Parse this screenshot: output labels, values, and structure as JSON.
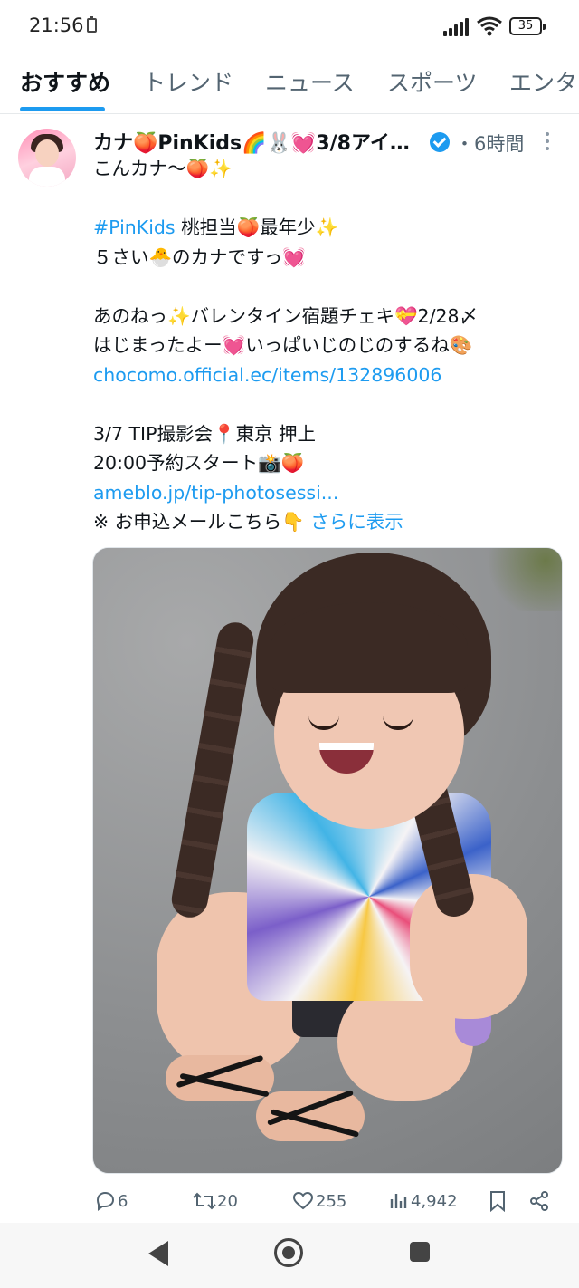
{
  "status_bar": {
    "time": "21:56",
    "battery": "35"
  },
  "tabs": [
    {
      "label": "おすすめ"
    },
    {
      "label": "トレンド"
    },
    {
      "label": "ニュース"
    },
    {
      "label": "スポーツ"
    },
    {
      "label": "エンタ…"
    }
  ],
  "tweet": {
    "display_name": "カナ🍑PinKids🌈🐰💓3/8アイ…",
    "time_ago": "・6時間",
    "text_lines": [
      "こんカナ〜🍑✨",
      "",
      "#PinKids 桃担当🍑最年少✨",
      "５さい🐣のカナですっ💓",
      "",
      "あのねっ✨バレンタイン宿題チェキ💝2/28〆",
      "はじまったよー💓いっぱいじのじのするね🎨",
      "chocomo.official.ec/items/132896006",
      "",
      "3/7 TIP撮影会📍東京 押上",
      " 20:00予約スタート📸🍑",
      "ameblo.jp/tip-photosessi..."
    ],
    "hashtag": "#PinKids",
    "hashtag_rest": " 桃担当🍑最年少✨",
    "last_line_prefix": "※ お申込メールこちら👇 ",
    "show_more": "さらに表示",
    "photo_alt": "smiling child with braided pigtails crouching outdoors"
  },
  "actions": {
    "replies": "6",
    "retweets": "20",
    "likes": "255",
    "views": "4,942"
  },
  "icons": [
    "reply-icon",
    "retweet-icon",
    "heart-icon",
    "views-icon",
    "bookmark-icon",
    "share-icon",
    "verified-badge-icon",
    "more-icon"
  ],
  "colors": {
    "accent": "#1d9bf0",
    "text": "#0f1419",
    "muted": "#536471"
  }
}
